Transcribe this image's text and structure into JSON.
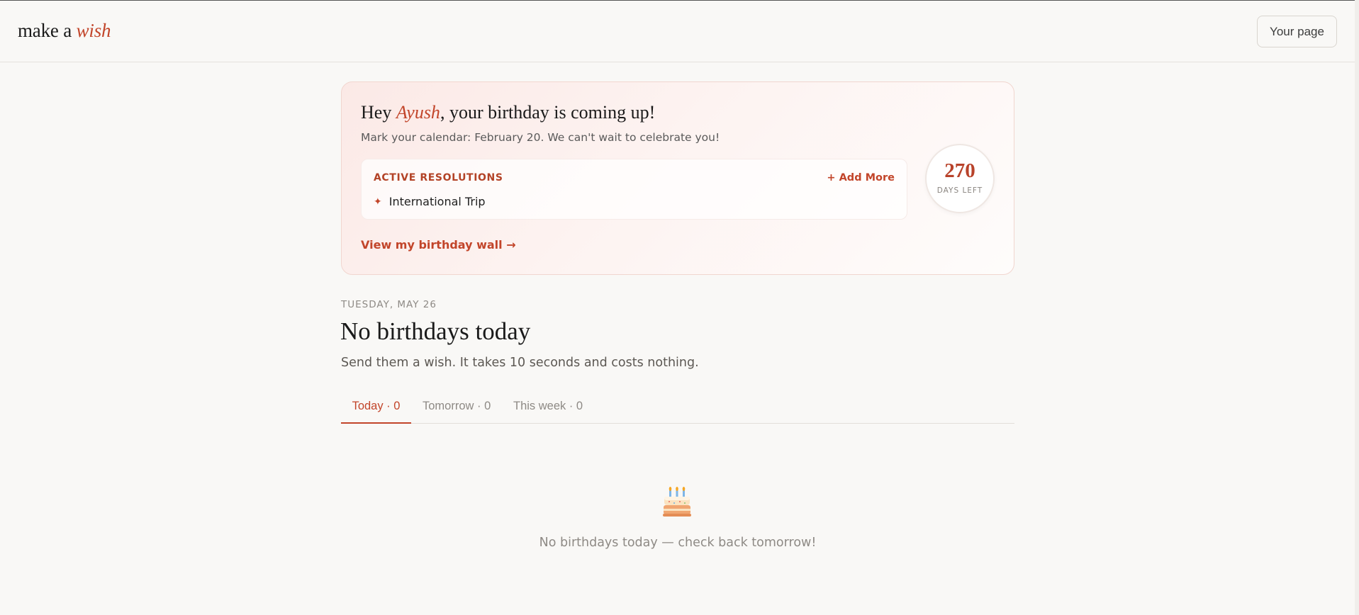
{
  "header": {
    "brand_prefix": "make a",
    "brand_accent": "wish",
    "your_page_label": "Your page"
  },
  "card": {
    "greeting_prefix": "Hey",
    "greeting_name": "Ayush",
    "greeting_suffix": ", your birthday is coming up!",
    "subline": "Mark your calendar: February 20. We can't wait to celebrate you!",
    "resolutions_title": "ACTIVE RESOLUTIONS",
    "add_more_label": "+ Add More",
    "resolutions": [
      {
        "icon": "sparkle-icon",
        "label": "International Trip"
      }
    ],
    "wall_link_label": "View my birthday wall →",
    "countdown_value": "270",
    "countdown_label": "DAYS LEFT"
  },
  "main": {
    "date_label": "TUESDAY, MAY 26",
    "title": "No birthdays today",
    "subtitle": "Send them a wish. It takes 10 seconds and costs nothing.",
    "tabs": [
      {
        "label": "Today · 0",
        "active": true
      },
      {
        "label": "Tomorrow · 0",
        "active": false
      },
      {
        "label": "This week · 0",
        "active": false
      }
    ],
    "empty_icon": "birthday-cake-icon",
    "empty_text": "No birthdays today — check back tomorrow!"
  },
  "colors": {
    "accent": "#c2452a",
    "background": "#f9f8f6",
    "muted_text": "#8e8a85"
  }
}
